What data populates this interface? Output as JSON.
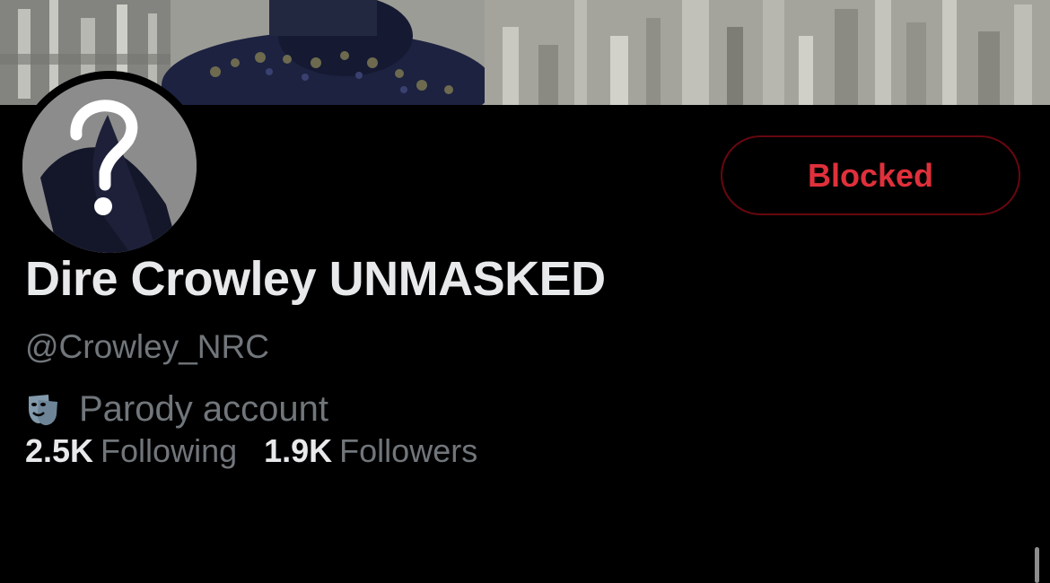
{
  "profile": {
    "display_name": "Dire Crowley UNMASKED",
    "handle": "@Crowley_NRC",
    "label": "Parody account",
    "label_icon": "theater-masks-icon",
    "avatar_icon": "question-mark-icon"
  },
  "actions": {
    "blocked_label": "Blocked"
  },
  "stats": {
    "following_count": "2.5K",
    "following_label": "Following",
    "followers_count": "1.9K",
    "followers_label": "Followers"
  },
  "colors": {
    "background": "#000000",
    "primary_text": "#e7e9ea",
    "secondary_text": "#71767b",
    "blocked_red": "#f4212e",
    "blocked_border": "#67070f"
  }
}
